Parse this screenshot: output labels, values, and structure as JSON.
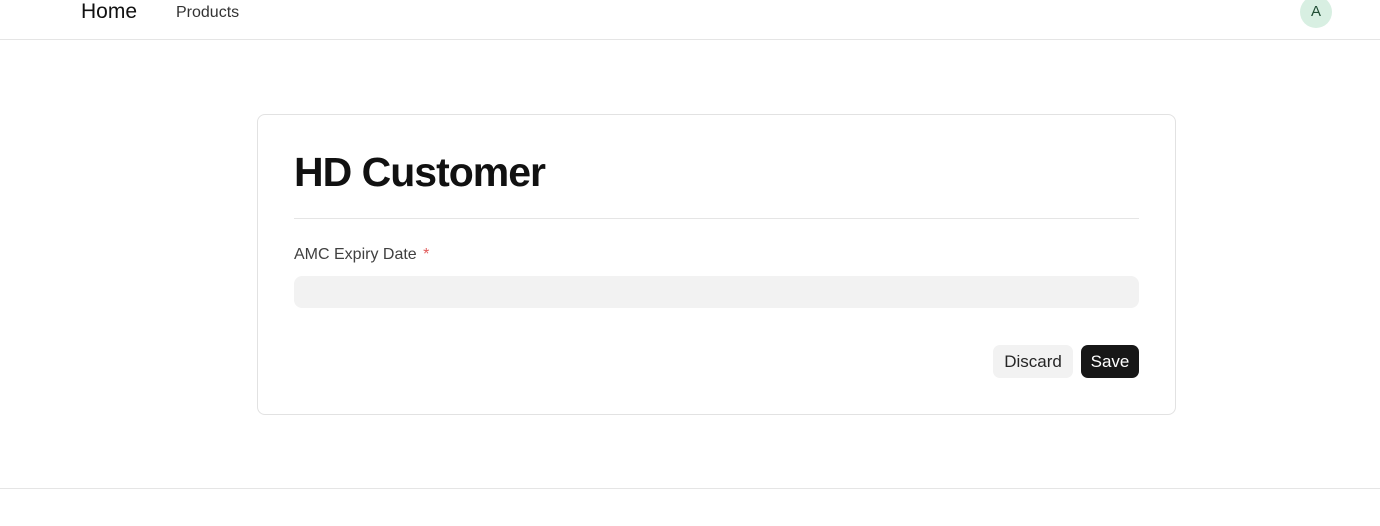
{
  "navbar": {
    "home_label": "Home",
    "products_label": "Products",
    "avatar_initial": "A"
  },
  "form": {
    "title": "HD Customer",
    "field_label": "AMC Expiry Date",
    "required_mark": "*",
    "field_value": "",
    "field_placeholder": "",
    "discard_label": "Discard",
    "save_label": "Save"
  },
  "colors": {
    "primary_button": "#171717",
    "secondary_button": "#f2f2f2",
    "required": "#e15b5b",
    "avatar_bg": "#d8efe2",
    "input_bg": "#f2f2f2"
  }
}
